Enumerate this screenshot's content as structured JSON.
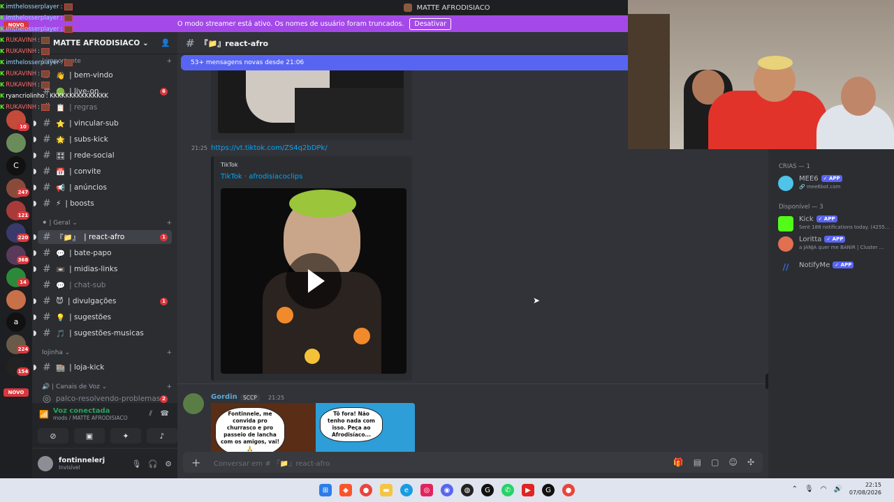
{
  "window": {
    "title": "MATTE AFRODISIACO"
  },
  "banner": {
    "text": "O modo streamer está ativo. Os nomes de usuário foram truncados.",
    "button": "Desativar"
  },
  "overlay_chat": [
    {
      "user": "imthelosserplayer",
      "text": ":",
      "color": "u1"
    },
    {
      "user": "imthelosserplayer",
      "text": ":",
      "color": "u1"
    },
    {
      "user": "imthelosserplayer",
      "text": ":",
      "color": "u1"
    },
    {
      "user": "RUKAVINH",
      "text": ":",
      "color": "u2"
    },
    {
      "user": "RUKAVINH",
      "text": ":",
      "color": "u2"
    },
    {
      "user": "imthelosserplayer",
      "text": ":",
      "color": "u1"
    },
    {
      "user": "RUKAVINH",
      "text": ":",
      "color": "u2"
    },
    {
      "user": "RUKAVINH",
      "text": ":",
      "color": "u2"
    },
    {
      "user": "ryancriolinho",
      "text": ": KKKKKKKKKKKKKKK",
      "color": "u3"
    },
    {
      "user": "RUKAVINH",
      "text": ":",
      "color": "u2"
    }
  ],
  "rail": {
    "badges": [
      "10",
      "247",
      "121",
      "220",
      "368",
      "14",
      "224",
      "154"
    ],
    "novo": "NOVO",
    "letter_c": "C",
    "letter_a": "a"
  },
  "server": {
    "name": "MATTE AFRODISIACO"
  },
  "channels": {
    "cat_top": "| importante",
    "items_top": [
      {
        "name": "| bem-vindo",
        "emoji": "👋",
        "unread": ""
      },
      {
        "name": "| live-on",
        "emoji": "🟢",
        "unread": "6"
      },
      {
        "name": "| regras",
        "emoji": "📋",
        "unread": ""
      },
      {
        "name": "| vincular-sub",
        "emoji": "⭐",
        "unread": ""
      },
      {
        "name": "| subs-kick",
        "emoji": "🌟",
        "unread": ""
      },
      {
        "name": "| rede-social",
        "emoji": "🎛",
        "unread": ""
      },
      {
        "name": "| convite",
        "emoji": "📅",
        "unread": ""
      },
      {
        "name": "| anúncios",
        "emoji": "📢",
        "unread": ""
      },
      {
        "name": "| boosts",
        "emoji": "⚡",
        "unread": ""
      }
    ],
    "cat_geral": "| Geral",
    "items_geral": [
      {
        "name": "| react-afro",
        "emoji": "『📁』",
        "unread": "1"
      },
      {
        "name": "| bate-papo",
        "emoji": "💬",
        "unread": ""
      },
      {
        "name": "| midias-links",
        "emoji": "📼",
        "unread": ""
      },
      {
        "name": "| chat-sub",
        "emoji": "💬",
        "unread": ""
      },
      {
        "name": "| divulgações",
        "emoji": "😈",
        "unread": "1"
      },
      {
        "name": "| sugestões",
        "emoji": "💡",
        "unread": ""
      },
      {
        "name": "| sugestões-musicas",
        "emoji": "🎵",
        "unread": ""
      }
    ],
    "cat_lojinha": "lojinha",
    "items_lojinha": [
      {
        "name": "| loja-kick",
        "emoji": "🏬",
        "unread": ""
      }
    ],
    "cat_voz": "| Canais de Voz",
    "voice_channel": "palco-resolvendo-problemas",
    "voice_badge": "2"
  },
  "voice": {
    "status": "Voz conectada",
    "location": "mods / MATTE AFRODISIACO"
  },
  "user": {
    "name": "fontinnelerj",
    "status": "Invisível"
  },
  "chat": {
    "channel": "『📁』react-afro",
    "new_messages": "53+ mensagens novas desde 21:06",
    "link_time": "21:25",
    "link": "https://vt.tiktok.com/ZS4q2bDPk/",
    "embed_provider": "TikTok",
    "embed_title": "TikTok · afrodisiacoclips",
    "msg2_author": "Gordin",
    "msg2_tag": "SCCP",
    "msg2_time": "21:25",
    "comic_left": "Fontinnele, me convida pro churrasco e pro passeio de lancha com os amigos, vai! 🙏",
    "comic_right": "Tô fora! Não tenho nada com isso. Peça ao Afrodisíaco...",
    "composer_placeholder": "Conversar em # 『📁』react-afro"
  },
  "members": {
    "cat1": "CRIAS — 1",
    "cat2": "Disponível — 3",
    "list1": [
      {
        "name": "MEE6",
        "status": "🔗 mee6bot.com",
        "color": "#4fc3e8"
      }
    ],
    "list2": [
      {
        "name": "Kick",
        "status": "Sent 188 notifications today. (4255...",
        "color": "#53fc18"
      },
      {
        "name": "Loritta",
        "status": "a JANJA quer me BANIR | Cluster ...",
        "color": "#e0704f"
      },
      {
        "name": "NotifyMe",
        "status": "",
        "color": "#3b6bd8"
      }
    ],
    "app_label": "✓ APP"
  },
  "taskbar": {
    "time": "22:15",
    "date": "07/08/2026"
  },
  "colors": {
    "accent": "#5865f2",
    "banner": "#a449e8",
    "unread": "#da373c",
    "link": "#00a8fc"
  }
}
